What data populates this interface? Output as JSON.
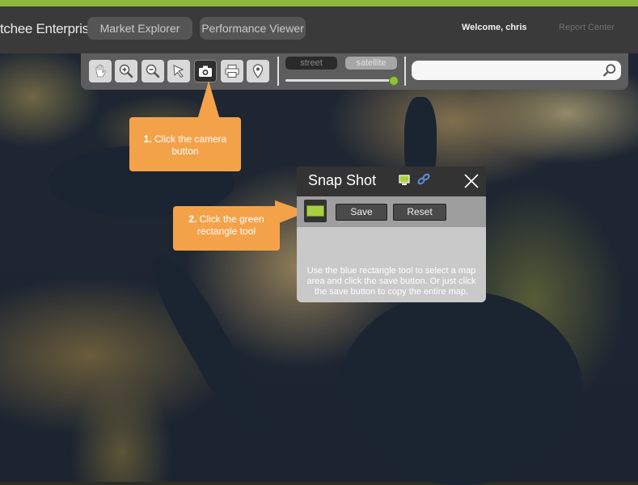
{
  "header": {
    "brand": "tchee Enterprise",
    "brand_mark": "®",
    "nav": [
      {
        "label": "Market Explorer"
      },
      {
        "label": "Performance Viewer"
      }
    ],
    "welcome": "Welcome, chris",
    "report_center": "Report Center"
  },
  "toolbar": {
    "tools": [
      {
        "icon": "hand-icon"
      },
      {
        "icon": "zoom-in-icon"
      },
      {
        "icon": "zoom-out-icon"
      },
      {
        "icon": "pointer-icon"
      },
      {
        "icon": "camera-icon",
        "active": true
      },
      {
        "icon": "print-icon"
      },
      {
        "icon": "location-pin-icon"
      }
    ],
    "map_types": {
      "street": "street",
      "satellite": "satellite"
    },
    "search": {
      "value": "",
      "placeholder": ""
    }
  },
  "callouts": {
    "step1_number": "1.",
    "step1_text": "Click the camera button",
    "step2_number": "2.",
    "step2_text": "Click the green rectangle tool"
  },
  "snapshot": {
    "title": "Snap Shot",
    "save_label": "Save",
    "reset_label": "Reset",
    "help": "Use the blue rectangle tool to select a map area and click the save button. Or just click the save button to copy the entire map."
  },
  "colors": {
    "accent": "#8cb83c",
    "callout": "#f4a24a",
    "header": "#3a3a3a",
    "rectangle_tool": "#a9d03e"
  }
}
